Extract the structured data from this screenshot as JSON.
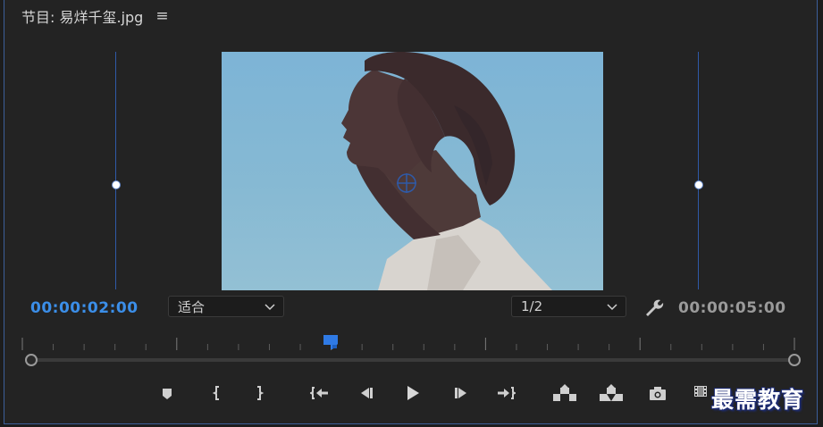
{
  "panel": {
    "title": "节目: 易烊千玺.jpg",
    "menu_icon": "hamburger-icon"
  },
  "monitor": {
    "current_time": "00:00:02:00",
    "duration": "00:00:05:00",
    "zoom_select": {
      "value": "适合"
    },
    "resolution_select": {
      "value": "1/2"
    },
    "settings_icon": "wrench-icon",
    "playhead_position": 0.4
  },
  "controls": [
    {
      "name": "add-marker-button",
      "icon": "marker-icon"
    },
    {
      "name": "mark-in-button",
      "icon": "mark-in-icon"
    },
    {
      "name": "mark-out-button",
      "icon": "mark-out-icon"
    },
    {
      "name": "go-to-in-button",
      "icon": "go-to-in-icon"
    },
    {
      "name": "step-back-button",
      "icon": "step-back-icon"
    },
    {
      "name": "play-button",
      "icon": "play-icon"
    },
    {
      "name": "step-forward-button",
      "icon": "step-forward-icon"
    },
    {
      "name": "go-to-out-button",
      "icon": "go-to-out-icon"
    },
    {
      "name": "lift-button",
      "icon": "lift-icon"
    },
    {
      "name": "extract-button",
      "icon": "extract-icon"
    },
    {
      "name": "export-frame-button",
      "icon": "camera-icon"
    },
    {
      "name": "compare-view-button",
      "icon": "film-icon"
    }
  ],
  "colors": {
    "accent": "#3b8ee8",
    "guide": "#2f5aa8",
    "panel_border": "#3c5f9a",
    "background": "#232323"
  },
  "watermark": {
    "text": "最需教育"
  }
}
